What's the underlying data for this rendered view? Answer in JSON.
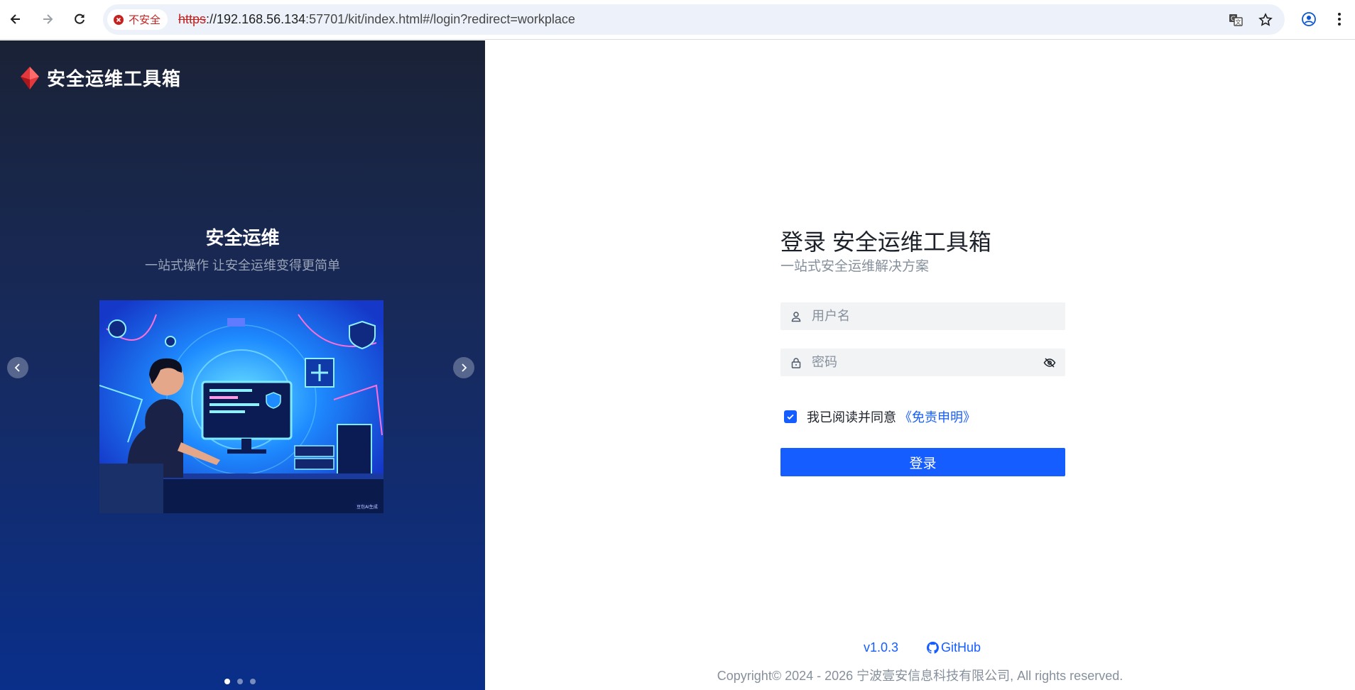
{
  "browser": {
    "security_chip": "不安全",
    "url_scheme": "https",
    "url_host": "://192.168.56.134",
    "url_rest": ":57701/kit/index.html#/login?redirect=workplace",
    "icons": [
      "back-icon",
      "forward-icon",
      "reload-icon",
      "translate-icon",
      "star-icon",
      "profile-icon",
      "menu-icon"
    ]
  },
  "brand": {
    "title": "安全运维工具箱"
  },
  "carousel": {
    "title": "安全运维",
    "subtitle": "一站式操作 让安全运维变得更简单",
    "active_index": 0,
    "slide_count": 3,
    "watermark": "豆包AI生成"
  },
  "login": {
    "title": "登录 安全运维工具箱",
    "subtitle": "一站式安全运维解决方案",
    "username_placeholder": "用户名",
    "password_placeholder": "密码",
    "agree_checked": true,
    "agree_text": "我已阅读并同意",
    "agree_link": "《免责申明》",
    "submit_label": "登录"
  },
  "footer": {
    "version": "v1.0.3",
    "github": "GitHub",
    "copyright": "Copyright© 2024 - 2026 宁波壹安信息科技有限公司, All rights reserved."
  },
  "colors": {
    "primary": "#165dff",
    "danger": "#c5221f",
    "panel_top": "#1a2236",
    "panel_bottom": "#0a2f8a"
  }
}
